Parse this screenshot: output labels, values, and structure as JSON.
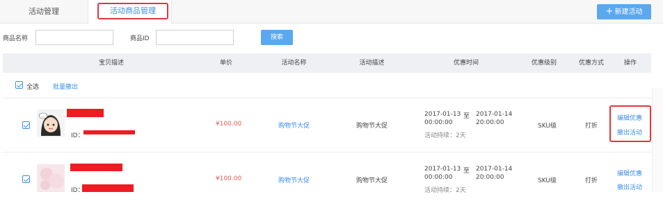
{
  "tabs": [
    {
      "label": "活动管理",
      "active": false
    },
    {
      "label": "活动商品管理",
      "active": true
    }
  ],
  "new_button_label": "新建活动",
  "search": {
    "name_label": "商品名称",
    "name_value": "",
    "id_label": "商品ID",
    "id_value": "",
    "button_label": "搜索"
  },
  "table": {
    "headers": [
      "宝贝描述",
      "单价",
      "活动名称",
      "活动描述",
      "优惠时间",
      "优惠级别",
      "优惠方式",
      "操作"
    ],
    "select_all_label": "全选",
    "batch_withdraw_label": "批量撤出",
    "rows": [
      {
        "checked": true,
        "id_prefix": "ID：",
        "price": "¥100.00",
        "activity_name": "购物节大促",
        "activity_desc": "购物节大促",
        "start_date": "2017-01-13",
        "start_time": "00:00:00",
        "to": "至",
        "end_date": "2017-01-14",
        "end_time": "20:00:00",
        "duration": "活动持续：2天",
        "level": "SKU级",
        "method": "打折",
        "op_edit": "编辑优惠",
        "op_withdraw": "撤出活动"
      },
      {
        "checked": true,
        "id_prefix": "ID：",
        "price": "¥100.00",
        "activity_name": "购物节大促",
        "activity_desc": "购物节大促",
        "start_date": "2017-01-13",
        "start_time": "00:00:00",
        "to": "至",
        "end_date": "2017-01-14",
        "end_time": "20:00:00",
        "duration": "活动持续：2天",
        "level": "SKU级",
        "method": "打折",
        "op_edit": "编辑优惠",
        "op_withdraw": "撤出活动"
      }
    ]
  },
  "colors": {
    "accent": "#3a8ee6",
    "button": "#5aa8f0",
    "highlight": "#e0353b",
    "price": "#e05a5a"
  }
}
